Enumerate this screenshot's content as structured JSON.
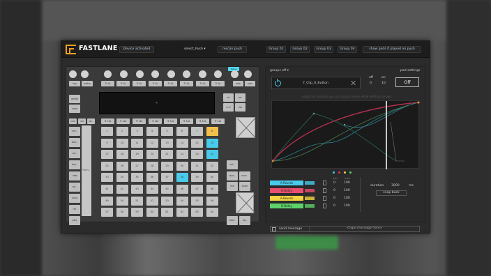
{
  "header": {
    "brand": "FASTLANE",
    "brand_sub": "...",
    "device_status": "Device activated",
    "device_select": "select_Push",
    "rescan": "rescan push",
    "groups": [
      "Group 01",
      "Group 02",
      "Group 03",
      "Group 04"
    ],
    "show_pads": "show pads if played on push"
  },
  "left": {
    "follow": "follow",
    "top_buttons": [
      "tap",
      "metro",
      "Tr 1b",
      "Tr 1b",
      "Tr 1b",
      "Tr 1b",
      "Tr 1b",
      "Tr 1b",
      "Tr 1b",
      "Tr 1b",
      "solo",
      "user"
    ],
    "side_left": [
      "delete",
      "undo"
    ],
    "side_right_top": [
      "scl",
      "rec",
      "u-Cl",
      "clip"
    ],
    "screen_value": "-",
    "row_labels": [
      "mut",
      "sel",
      "de..",
      "Tr 1bt",
      "Tr 1bt",
      "Tr 1bt",
      "Tr 1bt",
      "Tr 1bt",
      "Tr 1bt",
      "Tr 1bt",
      "Tr 1bt"
    ],
    "left_col": [
      "cen..",
      "dou..",
      "sel..",
      "dou..",
      "new",
      "sel..",
      "auto",
      "rec",
      "play"
    ],
    "right_col": [
      "layo..",
      "acce..",
      "nte",
      "scale",
      "repe..",
      "lay..",
      "oct.."
    ],
    "strip_label": "Trans..",
    "pads": [
      [
        "1",
        "2",
        "3",
        "4",
        "5",
        "6",
        "7",
        "8"
      ],
      [
        "9",
        "10",
        "11",
        "12",
        "13",
        "14",
        "15",
        "16"
      ],
      [
        "17",
        "18",
        "19",
        "20",
        "21",
        "22",
        "23",
        "24"
      ],
      [
        "25",
        "26",
        "27",
        "28",
        "29",
        "30",
        "31",
        "32"
      ],
      [
        "33",
        "34",
        "35",
        "36",
        "37",
        "38",
        "39",
        "40"
      ],
      [
        "41",
        "42",
        "43",
        "44",
        "45",
        "46",
        "47",
        "48"
      ],
      [
        "49",
        "50",
        "51",
        "52",
        "53",
        "54",
        "55",
        "56"
      ],
      [
        "57",
        "58",
        "59",
        "60",
        "61",
        "62",
        "63",
        "64"
      ]
    ],
    "highlighted_yellow": [
      "8"
    ],
    "highlighted_cyan": [
      "16",
      "24",
      "38"
    ]
  },
  "right": {
    "groups_off": "groups off",
    "clip_name": "7_Clip_0_Button",
    "off_label": "off",
    "on_label": "on",
    "off_value": "0",
    "on_value": "10",
    "pad_settings": "pad settings",
    "pad_toggle": "Off",
    "hint": "using this function you can control videos while holding the pad",
    "dots_colors": [
      "#48cbea",
      "#e2325a",
      "#f2d440",
      "#5dd26a"
    ],
    "sends": [
      {
        "name": "A-Reverb",
        "color": "#48cbea",
        "min": "0",
        "max": "100"
      },
      {
        "name": "B-Delay",
        "color": "#e94f6f",
        "min": "0",
        "max": "100"
      },
      {
        "name": "A-Reverb",
        "color": "#f2d440",
        "min": "0",
        "max": "100"
      },
      {
        "name": "B-Delay",
        "color": "#5dd26a",
        "min": "0",
        "max": "100"
      }
    ],
    "min_label": "min",
    "max_label": "max",
    "duration_label": "duration",
    "duration_value": "3000",
    "duration_unit": "ms",
    "snap_back": "snap back",
    "send_message": "send message",
    "message_placeholder": "<type message here>"
  }
}
